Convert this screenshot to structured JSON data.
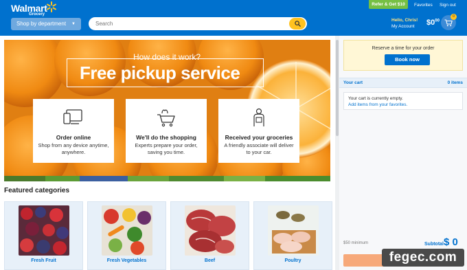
{
  "header": {
    "logo_main": "Walmart",
    "logo_sub": "Grocery",
    "shop_by_department": "Shop by department",
    "search_placeholder": "Search",
    "refer": "Refer & Get $10",
    "favorites": "Favorites",
    "sign_out": "Sign out",
    "hello": "Hello, Chris!",
    "my_account": "My Account",
    "cart_total_dollars": "$0",
    "cart_total_cents": "00",
    "cart_count": "0"
  },
  "hero": {
    "subtitle": "How does it work?",
    "title": "Free pickup service",
    "cards": [
      {
        "title": "Order online",
        "desc": "Shop from any device anytime, anywhere.",
        "icon": "device-icon"
      },
      {
        "title": "We'll do the shopping",
        "desc": "Experts prepare your order, saving you time.",
        "icon": "basket-icon"
      },
      {
        "title": "Received your groceries",
        "desc": "A friendly associate will deliver to your car.",
        "icon": "associate-icon"
      }
    ]
  },
  "featured": {
    "title": "Featured categories",
    "categories": [
      {
        "label": "Fresh Fruit"
      },
      {
        "label": "Fresh Vegetables"
      },
      {
        "label": "Beef"
      },
      {
        "label": "Poultry"
      }
    ]
  },
  "side": {
    "reserve_text": "Reserve a time for your order",
    "book_now": "Book now",
    "your_cart": "Your cart",
    "items_count": "0 items",
    "empty_text": "Your cart is currently empty.",
    "add_items": "Add items from your favorites.",
    "minimum": "$50 minimum",
    "subtotal_label": "Subtotal",
    "subtotal_value": "$ 0"
  },
  "watermark": "fegec.com",
  "colors": {
    "brand_blue": "#0071ce",
    "accent_yellow": "#ffc220",
    "refer_green": "#76c043"
  }
}
